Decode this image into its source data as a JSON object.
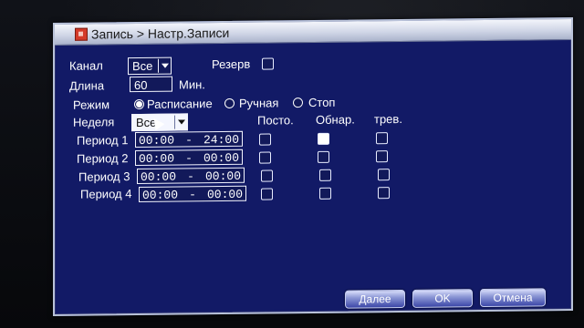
{
  "title": "Запись > Настр.Записи",
  "channel": {
    "label": "Канал",
    "value": "Все"
  },
  "reserve": {
    "label": "Резерв",
    "checked": false
  },
  "length": {
    "label": "Длина",
    "value": "60",
    "unit": "Мин."
  },
  "mode": {
    "label": "Режим",
    "options": [
      {
        "label": "Расписание",
        "checked": true
      },
      {
        "label": "Ручная",
        "checked": false
      },
      {
        "label": "Стоп",
        "checked": false
      }
    ]
  },
  "week": {
    "label": "Неделя",
    "value": "Все"
  },
  "columns": [
    "Посто.",
    "Обнар.",
    "трев."
  ],
  "periods": [
    {
      "label": "Период 1",
      "start": "00:00",
      "end": "24:00",
      "checks": [
        false,
        true,
        false
      ]
    },
    {
      "label": "Период 2",
      "start": "00:00",
      "end": "00:00",
      "checks": [
        false,
        false,
        false
      ]
    },
    {
      "label": "Период 3",
      "start": "00:00",
      "end": "00:00",
      "checks": [
        false,
        false,
        false
      ]
    },
    {
      "label": "Период 4",
      "start": "00:00",
      "end": "00:00",
      "checks": [
        false,
        false,
        false
      ]
    }
  ],
  "period_separator": "-",
  "buttons": {
    "more": "Далее",
    "ok": "OK",
    "cancel": "Отмена"
  },
  "colors": {
    "dialog_bg": "#121a66",
    "border": "#f2f4ff",
    "titlebar": "#cfd5e6"
  }
}
